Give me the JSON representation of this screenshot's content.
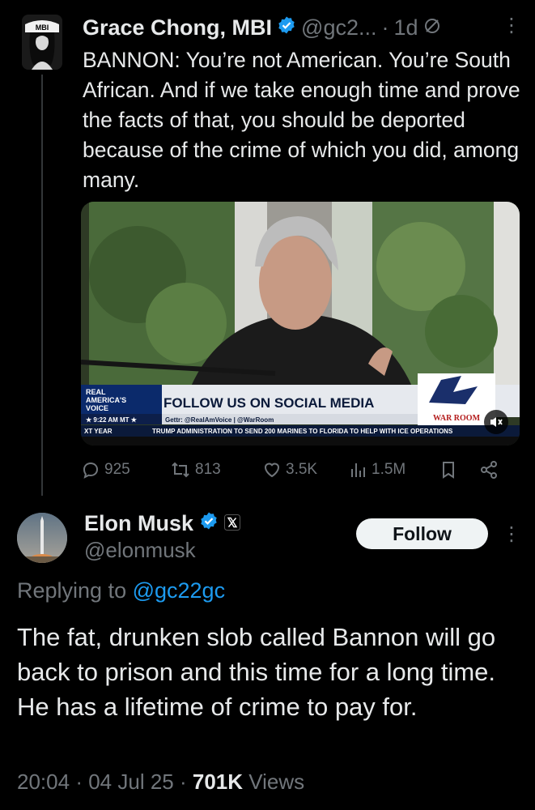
{
  "tweet1": {
    "author_name": "Grace Chong, MBI",
    "handle": "@gc2...",
    "separator": "·",
    "time": "1d",
    "more": "⋮",
    "avatar_badge": "MBI",
    "text": "BANNON: You’re not American. You’re South African. And if we take enough time and prove the facts of that, you should be deported because of the crime of which you did, among many.",
    "media": {
      "logo_line1": "REAL",
      "logo_line2": "AMERICA'S",
      "logo_line3": "VOICE",
      "time_tag": "★ 9:22 AM MT ★",
      "headline": "FOLLOW US ON SOCIAL MEDIA",
      "subline": "Gettr: @RealAmVoice | @WarRoom",
      "ticker_left": "XT YEAR",
      "ticker": "TRUMP ADMINISTRATION TO SEND 200 MARINES TO FLORIDA TO HELP WITH ICE OPERATIONS",
      "show_logo": "WAR ROOM"
    },
    "stats": {
      "replies": "925",
      "reposts": "813",
      "likes": "3.5K",
      "views": "1.5M"
    }
  },
  "tweet2": {
    "author_name": "Elon Musk",
    "handle": "@elonmusk",
    "follow_label": "Follow",
    "more": "⋮",
    "replying_prefix": "Replying to ",
    "replying_handle": "@gc22gc",
    "text": "The fat, drunken slob called Bannon will go back to prison and this time for a long time. He has a lifetime of crime to pay for.",
    "time": "20:04",
    "date": "04 Jul 25",
    "views_count": "701K",
    "views_label": "Views",
    "separator": "·"
  },
  "colors": {
    "background": "#000000",
    "text": "#e7e9ea",
    "muted": "#71767b",
    "accent": "#1d9bf0",
    "verified": "#1d9bf0"
  },
  "icons": [
    "verified-badge-icon",
    "no-reply-icon",
    "reply-icon",
    "repost-icon",
    "like-icon",
    "views-icon",
    "bookmark-icon",
    "share-icon",
    "x-logo-icon",
    "mute-icon"
  ]
}
